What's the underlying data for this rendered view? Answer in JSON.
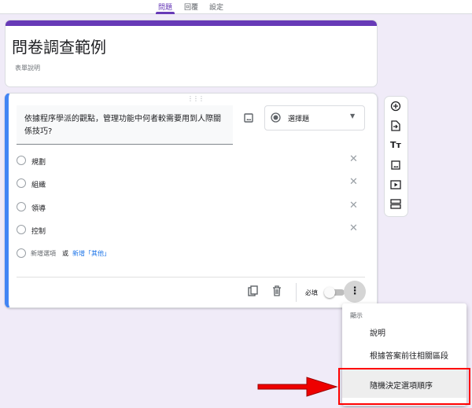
{
  "tabs": [
    {
      "label": "問題",
      "active": true
    },
    {
      "label": "回覆"
    },
    {
      "label": "設定"
    }
  ],
  "form": {
    "title": "問卷調查範例",
    "description_placeholder": "表單說明"
  },
  "question": {
    "text": "依據程序學派的觀點，管理功能中何者較需要用到人際關係技巧?",
    "type": "選擇題",
    "options": [
      "規劃",
      "組織",
      "領導",
      "控制"
    ],
    "add_option": "新增選項",
    "or": "或",
    "add_other": "新增「其他」",
    "required_label": "必填",
    "required": false
  },
  "side_toolbar": [
    "add-question-icon",
    "import-questions-icon",
    "title-text-icon",
    "image-icon",
    "video-icon",
    "section-icon"
  ],
  "menu": {
    "header": "顯示",
    "items": [
      "說明",
      "根據答案前往相關區段",
      "隨機決定選項順序"
    ]
  },
  "colors": {
    "accent": "#673ab7",
    "focus": "#4285f4",
    "highlight": "#ff0000"
  }
}
